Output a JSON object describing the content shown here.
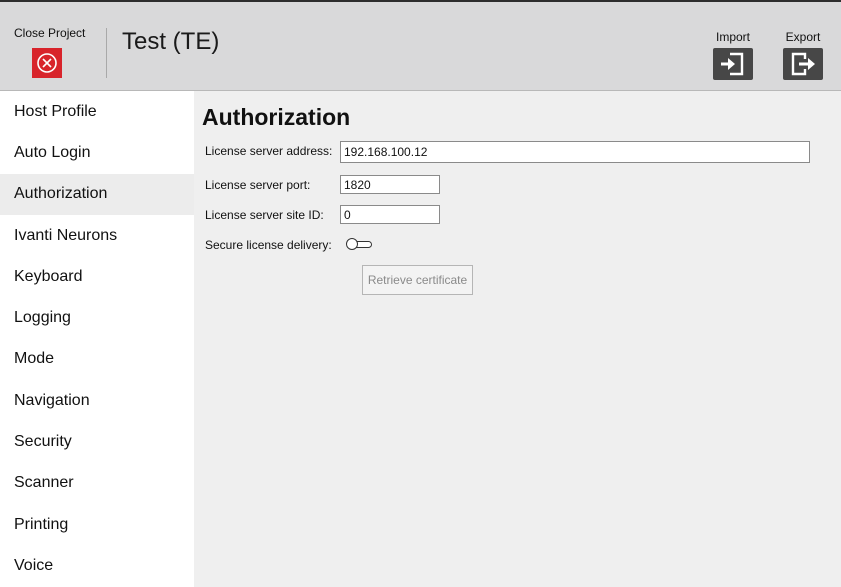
{
  "header": {
    "close_project_label": "Close Project",
    "project_title": "Test (TE)",
    "import_label": "Import",
    "export_label": "Export",
    "close_color": "#d8242b"
  },
  "sidebar": {
    "items": [
      {
        "label": "Host Profile"
      },
      {
        "label": "Auto Login"
      },
      {
        "label": "Authorization"
      },
      {
        "label": "Ivanti Neurons"
      },
      {
        "label": "Keyboard"
      },
      {
        "label": "Logging"
      },
      {
        "label": "Mode"
      },
      {
        "label": "Navigation"
      },
      {
        "label": "Security"
      },
      {
        "label": "Scanner"
      },
      {
        "label": "Printing"
      },
      {
        "label": "Voice"
      }
    ],
    "active": "Authorization"
  },
  "main": {
    "title": "Authorization",
    "fields": {
      "server_address": {
        "label": "License server address:",
        "value": "192.168.100.12"
      },
      "server_port": {
        "label": "License server port:",
        "value": "1820"
      },
      "site_id": {
        "label": "License server site ID:",
        "value": "0"
      },
      "secure_delivery": {
        "label": "Secure license delivery:",
        "enabled": false
      }
    },
    "retrieve_button_label": "Retrieve certificate"
  }
}
